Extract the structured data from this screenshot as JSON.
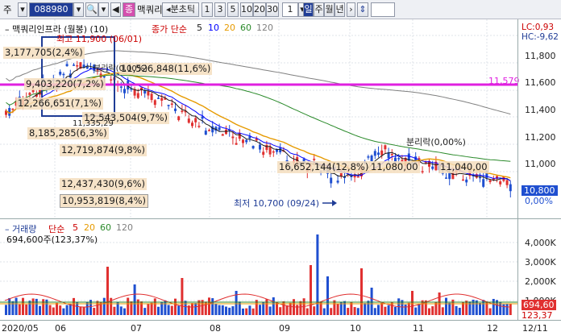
{
  "toolbar": {
    "prefix": "주",
    "code": "088980",
    "name": "맥쿼리",
    "item_badge": "종",
    "tick_label": "분초틱",
    "periods": [
      "1",
      "3",
      "5",
      "10",
      "20",
      "30"
    ],
    "count": "1",
    "day": "일",
    "week": "주",
    "month": "월",
    "year": "년"
  },
  "price_panel": {
    "title": "맥쿼리인프라 (월봉) (10)",
    "ma_title": "종가 단순",
    "ma_periods": [
      "5",
      "10",
      "20",
      "60",
      "120"
    ],
    "corner_high": "최고 11,900 (06/01)",
    "corner_lc": "LC:0,93",
    "corner_hc": "HC:-9,62",
    "hline_value": "11,579",
    "ticks": [
      "11,800",
      "11,600",
      "11,400",
      "11,200",
      "11,000",
      "10,800",
      "0,00%"
    ],
    "low_label": "최저 10,700 (09/24)",
    "separation_label": "분리락(0,00%)",
    "separation_label2": "분리락(0,00%)",
    "current_price": "10,800",
    "annotations": [
      "3,177,705(2,4%)",
      "8,185,285(6,3%)",
      "12,719,874(9,8%)",
      "12,437,430(9,6%)",
      "10,953,819(8,4%)",
      "11,526,848(11,6%)",
      "9,403,220(7,2%)",
      "12,266,651(7,1%)",
      "12,543,504(9,7%)",
      "11,335,29",
      "16,652,144(12,8%)",
      "11,080,00",
      "11,040,00"
    ]
  },
  "volume_panel": {
    "title": "거래량",
    "ma_title": "단순",
    "ma_periods": [
      "5",
      "20",
      "60",
      "120"
    ],
    "value": "694,600주(123,37%)",
    "ticks": [
      "4,000K",
      "3,000K",
      "2,000K",
      "1,000K"
    ],
    "current_value": "694,60",
    "current_pct": "123,37"
  },
  "dates": [
    "2020/05",
    "06",
    "07",
    "08",
    "09",
    "10",
    "11",
    "12",
    "12/11"
  ],
  "colors": {
    "up": "#e03030",
    "down": "#1f4fd0",
    "ma5": "#1a1a1a",
    "ma10": "#0000ff",
    "ma20": "#e69a00",
    "ma60": "#2a8a2a",
    "ma120": "#808080",
    "hline": "#e020e0",
    "accent": "#1f3c96"
  }
}
